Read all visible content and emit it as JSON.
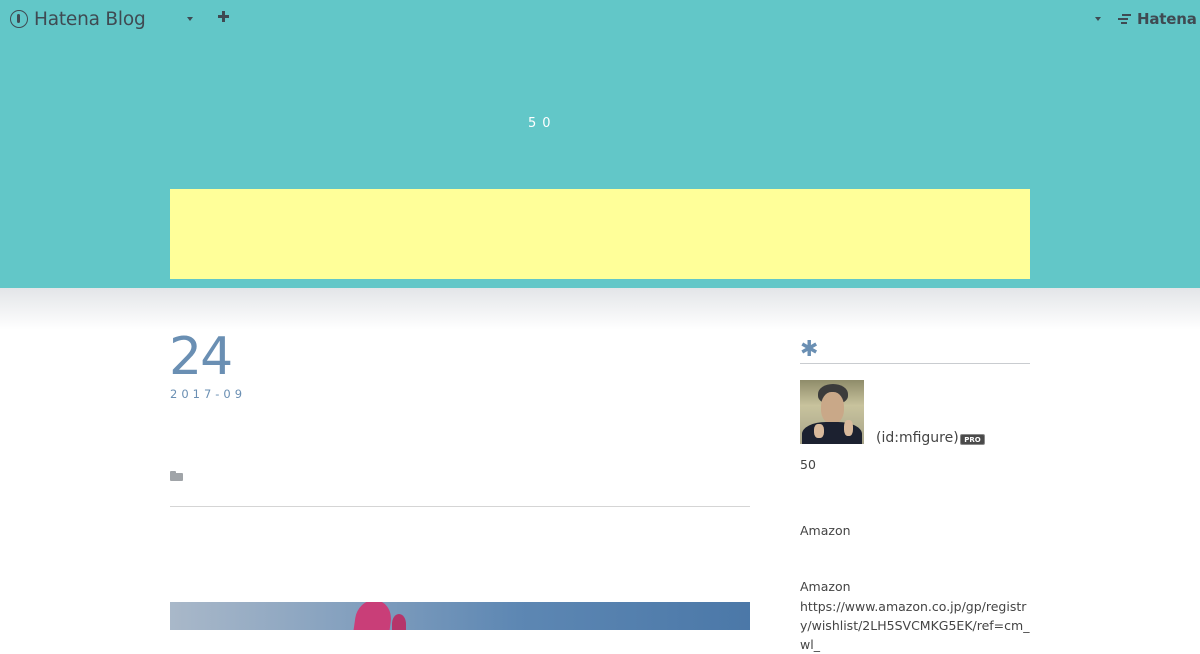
{
  "globalheader": {
    "brand_label": "Hatena Blog",
    "hatena_label": "Hatena",
    "icons": [
      "brand-logo-icon",
      "caret-down-icon",
      "plus-icon",
      "hatena-logo-icon"
    ]
  },
  "blog": {
    "description": "50"
  },
  "entry": {
    "day": "24",
    "month": "2017-09"
  },
  "sidebar": {
    "profile_id": "(id:mfigure)",
    "pro_badge": "PRO",
    "intro": "50",
    "amazon_1": "Amazon",
    "amazon_2": "Amazon",
    "wishlist_url": "https://www.amazon.co.jp/gp/registry/wishlist/2LH5SVCMKG5EK/ref=cm_wl_"
  },
  "colors": {
    "header_bg": "#62c7c8",
    "banner_bg": "#ffff99",
    "accent": "#6a8fb3",
    "text": "#444444"
  }
}
